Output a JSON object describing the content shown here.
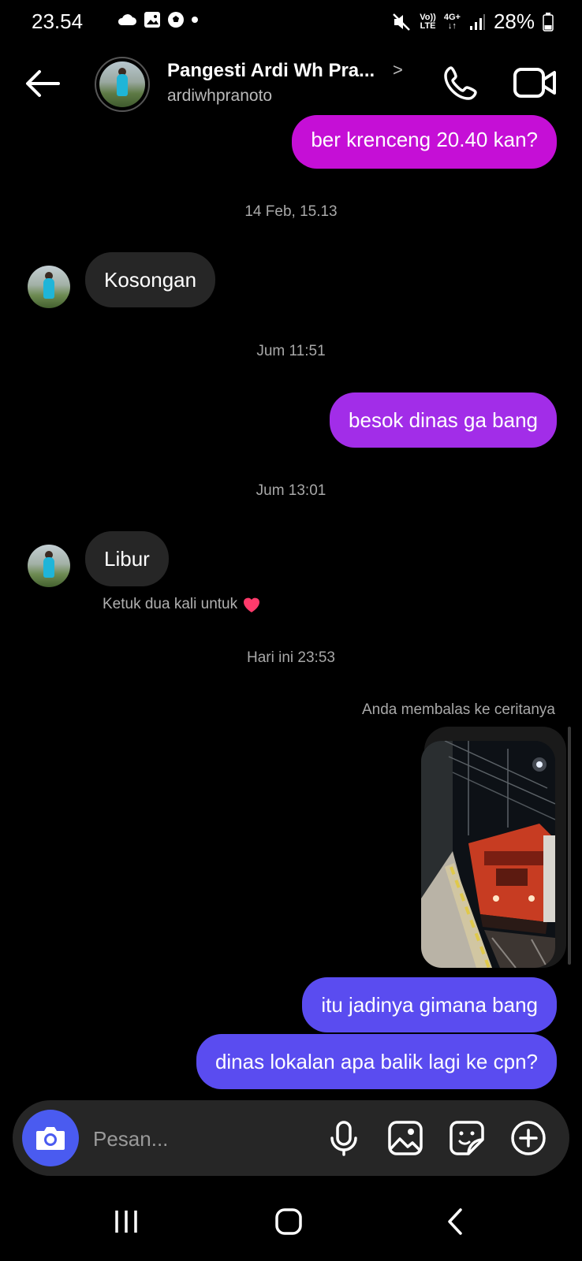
{
  "status_bar": {
    "time": "23.54",
    "network_top": "Vo))",
    "network_bottom": "LTE",
    "data_top": "4G+",
    "battery": "28%"
  },
  "header": {
    "name": "Pangesti Ardi Wh Pra...",
    "chevron": ">",
    "username": "ardiwhpranoto"
  },
  "messages": [
    {
      "type": "outgoing",
      "text": "ber krenceng 20.40 kan?",
      "color": "#c50fd6"
    },
    {
      "type": "timestamp",
      "text": "14 Feb, 15.13"
    },
    {
      "type": "incoming",
      "text": "Kosongan"
    },
    {
      "type": "timestamp",
      "text": "Jum 11:51"
    },
    {
      "type": "outgoing",
      "text": "besok dinas ga bang",
      "color": "#a22de8"
    },
    {
      "type": "timestamp",
      "text": "Jum 13:01"
    },
    {
      "type": "incoming",
      "text": "Libur"
    },
    {
      "type": "hint",
      "text": "Ketuk dua kali untuk"
    },
    {
      "type": "timestamp",
      "text": "Hari ini 23:53"
    },
    {
      "type": "story_reply_label",
      "text": "Anda membalas ke ceritanya"
    },
    {
      "type": "outgoing",
      "text": "itu jadinya gimana bang",
      "color": "#5a4cf0"
    },
    {
      "type": "outgoing",
      "text": "dinas lokalan apa balik lagi ke cpn?",
      "color": "#5a4cf0"
    }
  ],
  "composer": {
    "placeholder": "Pesan..."
  },
  "icons": {
    "left_status": [
      "cloud-icon",
      "gallery-icon",
      "soccer-icon",
      "dot-icon"
    ],
    "right_status": [
      "mute-icon",
      "signal-icon",
      "battery-icon"
    ],
    "composer": [
      "camera-icon",
      "microphone-icon",
      "image-icon",
      "sticker-icon",
      "plus-icon"
    ],
    "nav": [
      "recents-icon",
      "home-icon",
      "back-nav-icon"
    ]
  },
  "colors": {
    "background": "#000000",
    "incoming_bubble": "#262626",
    "composer_bg": "#262626",
    "camera_button": "#4a5bf0",
    "heart": "#ff3b6b"
  }
}
